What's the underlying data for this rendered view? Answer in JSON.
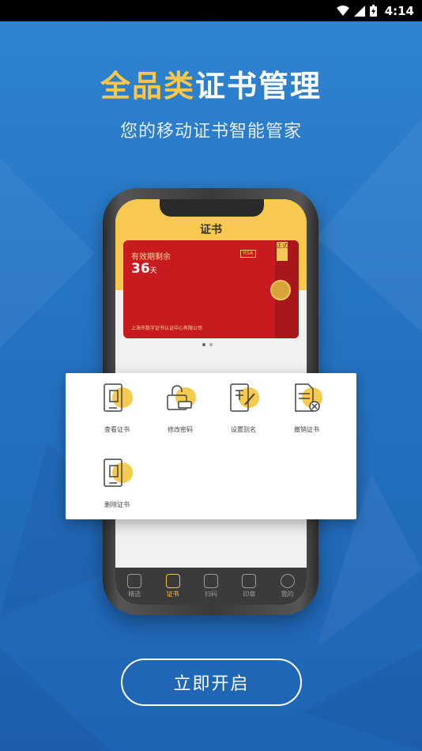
{
  "status_bar": {
    "time": "4:14",
    "icons": [
      "wifi-icon",
      "signal-icon",
      "battery-icon"
    ]
  },
  "hero": {
    "title_highlight": "全品类",
    "title_rest": "证书管理",
    "subtitle": "您的移动证书智能管家"
  },
  "phone_screen": {
    "title": "证书",
    "card": {
      "label": "有效期剩余",
      "days": "36",
      "days_unit": "天",
      "badge": "RSA",
      "tag": "正式",
      "issuer": "上海市数字证书认证中心有限公司"
    },
    "tabs": [
      {
        "label": "精选",
        "icon": "shield-icon",
        "active": false
      },
      {
        "label": "证书",
        "icon": "certificate-icon",
        "active": true
      },
      {
        "label": "扫码",
        "icon": "scan-icon",
        "active": false
      },
      {
        "label": "印章",
        "icon": "stamp-icon",
        "active": false
      },
      {
        "label": "我的",
        "icon": "user-icon",
        "active": false
      }
    ]
  },
  "actions": [
    {
      "label": "查看证书",
      "icon": "view-certificate-icon"
    },
    {
      "label": "修改密码",
      "icon": "change-password-icon"
    },
    {
      "label": "设置别名",
      "icon": "set-alias-icon"
    },
    {
      "label": "撤销证书",
      "icon": "revoke-certificate-icon"
    },
    {
      "label": "删除证书",
      "icon": "delete-certificate-icon"
    }
  ],
  "cta": {
    "label": "立即开启"
  },
  "colors": {
    "accent": "#f8c64a",
    "background": "#2a77c5",
    "card_red": "#c71b1f"
  }
}
